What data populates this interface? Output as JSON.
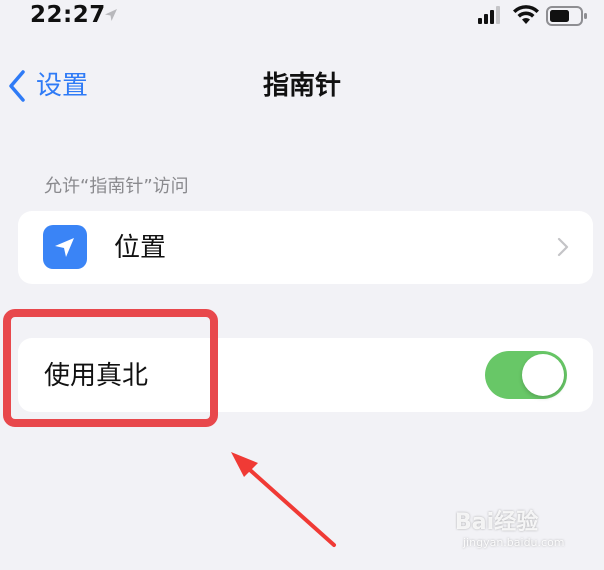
{
  "status_bar": {
    "time": "22:27",
    "icons": [
      "location-arrow-icon",
      "cellular-signal-icon",
      "wifi-icon",
      "battery-icon"
    ]
  },
  "nav": {
    "back_label": "设置",
    "title": "指南针"
  },
  "section": {
    "header": "允许“指南针”访问"
  },
  "location_row": {
    "label": "位置",
    "icon": "location-arrow-icon"
  },
  "true_north_row": {
    "label": "使用真北",
    "toggle_on": true
  },
  "colors": {
    "accent": "#2f7bf6",
    "toggle_on": "#68c767",
    "annotation": "#e8484c",
    "background": "#f2f2f6"
  },
  "watermark": {
    "brand": "Bai经验",
    "url": "jingyan.baidu.com"
  }
}
